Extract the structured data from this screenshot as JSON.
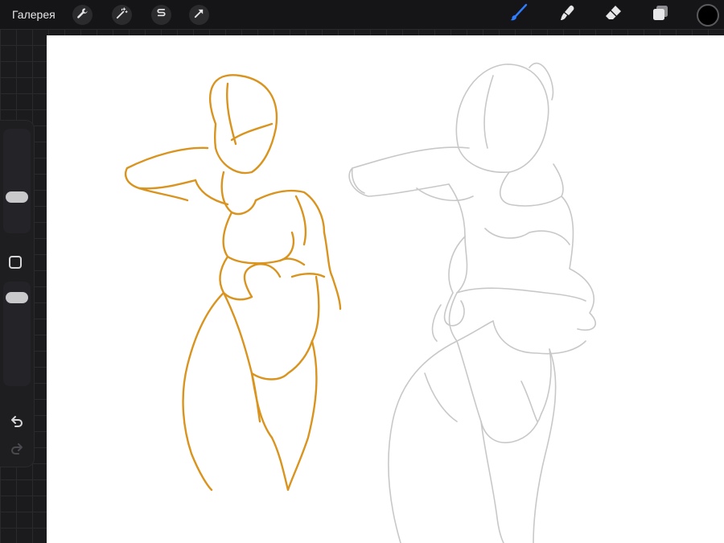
{
  "topbar": {
    "gallery_label": "Галерея",
    "tools_left": [
      {
        "icon": "wrench-icon"
      },
      {
        "icon": "magic-wand-icon"
      },
      {
        "icon": "selection-s-icon"
      },
      {
        "icon": "transform-arrow-icon"
      }
    ],
    "tools_right": [
      {
        "icon": "brush-icon",
        "active_color": "#2f7dff"
      },
      {
        "icon": "smudge-icon"
      },
      {
        "icon": "eraser-icon"
      },
      {
        "icon": "layers-icon"
      }
    ],
    "current_color": "#000000"
  },
  "sidebar": {
    "brush_size_level": 0.3,
    "opacity_level": 0.95,
    "icons": [
      "modify-square-icon",
      "undo-icon",
      "redo-icon"
    ]
  },
  "canvas": {
    "sketch_colors": {
      "ink": "#d9941f",
      "pencil": "#c8c8c8"
    }
  }
}
